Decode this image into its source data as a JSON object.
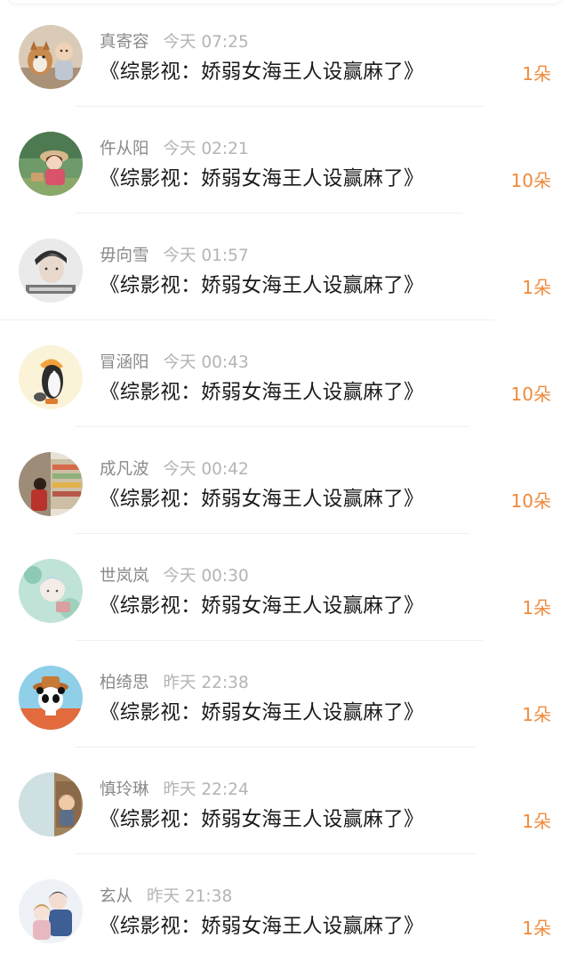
{
  "colors": {
    "name": "#8a8a8a",
    "time": "#b4b4b4",
    "title": "#1a1a1a",
    "gift": "#f08a3c",
    "divider": "#f0f0f0"
  },
  "items": [
    {
      "name": "真寄容",
      "time": "今天 07:25",
      "title": "《综影视：娇弱女海王人设赢麻了》",
      "gift": "1朵",
      "avatar": "dog-and-baby-avatar"
    },
    {
      "name": "仵从阳",
      "time": "今天 02:21",
      "title": "《综影视：娇弱女海王人设赢麻了》",
      "gift": "10朵",
      "avatar": "anime-girl-avatar"
    },
    {
      "name": "毋向雪",
      "time": "今天 01:57",
      "title": "《综影视：娇弱女海王人设赢麻了》",
      "gift": "1朵",
      "avatar": "young-man-avatar"
    },
    {
      "name": "冒涵阳",
      "time": "今天 00:43",
      "title": "《综影视：娇弱女海王人设赢麻了》",
      "gift": "10朵",
      "avatar": "penguin-avatar"
    },
    {
      "name": "成凡波",
      "time": "今天 00:42",
      "title": "《综影视：娇弱女海王人设赢麻了》",
      "gift": "10朵",
      "avatar": "store-photo-avatar"
    },
    {
      "name": "世岚岚",
      "time": "今天 00:30",
      "title": "《综影视：娇弱女海王人设赢麻了》",
      "gift": "1朵",
      "avatar": "floral-illustration-avatar"
    },
    {
      "name": "柏绮思",
      "time": "昨天 22:38",
      "title": "《综影视：娇弱女海王人设赢麻了》",
      "gift": "1朵",
      "avatar": "panda-cartoon-avatar"
    },
    {
      "name": "慎玲琳",
      "time": "昨天 22:24",
      "title": "《综影视：娇弱女海王人设赢麻了》",
      "gift": "1朵",
      "avatar": "child-photo-avatar"
    },
    {
      "name": "玄从",
      "time": "昨天 21:38",
      "title": "《综影视：娇弱女海王人设赢麻了》",
      "gift": "1朵",
      "avatar": "couple-illustration-avatar"
    }
  ]
}
